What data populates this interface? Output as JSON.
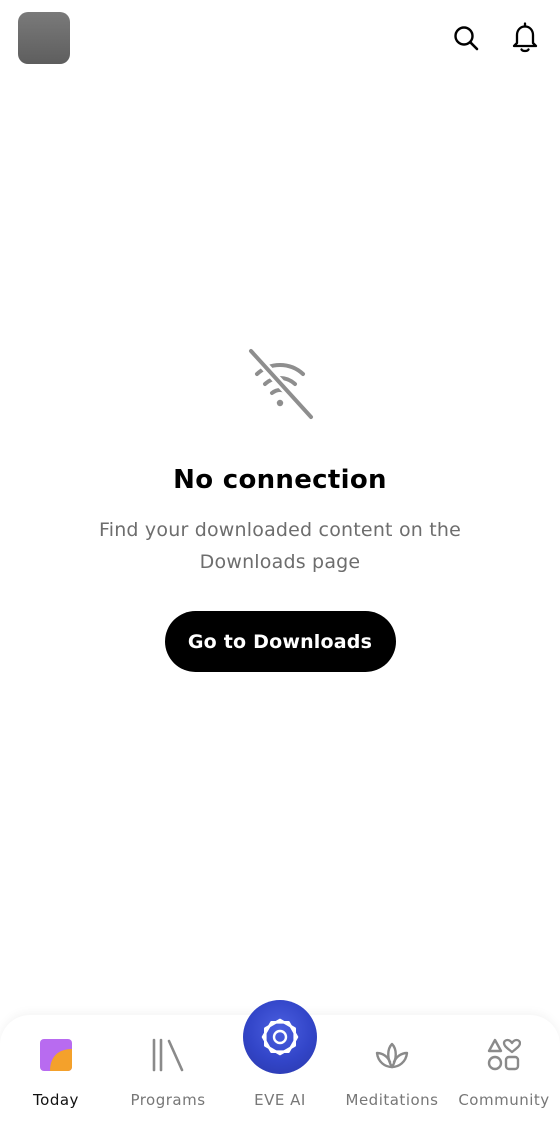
{
  "header": {
    "avatar_color": "#6b6b6b"
  },
  "empty_state": {
    "icon": "wifi-off-icon",
    "title": "No connection",
    "message_line1": "Find your downloaded content on the",
    "message_line2": "Downloads page",
    "button_label": "Go to Downloads"
  },
  "tabbar": {
    "items": [
      {
        "label": "Today",
        "icon": "today-icon",
        "active": true
      },
      {
        "label": "Programs",
        "icon": "library-icon",
        "active": false
      },
      {
        "label": "EVE AI",
        "icon": "eve-ai-icon",
        "active": false
      },
      {
        "label": "Meditations",
        "icon": "lotus-icon",
        "active": false
      },
      {
        "label": "Community",
        "icon": "shapes-icon",
        "active": false
      }
    ]
  },
  "colors": {
    "accent_blue": "#3245c8",
    "today_purple": "#b86bf0",
    "today_orange": "#f4a12b",
    "button_bg": "#000000"
  }
}
